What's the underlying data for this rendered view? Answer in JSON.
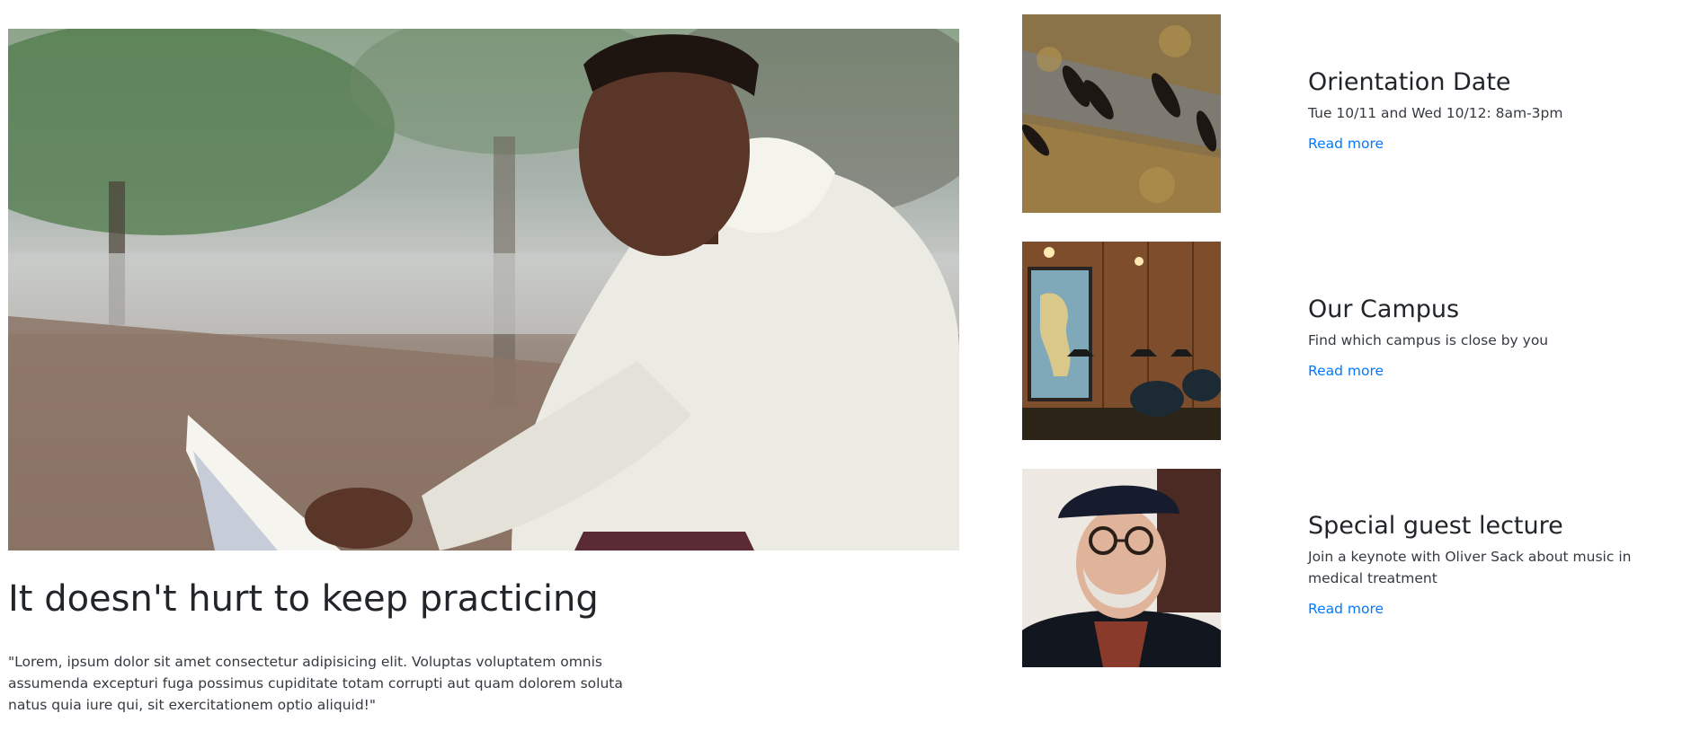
{
  "hero": {
    "image": "student-reading-book-photo",
    "title": "It doesn't hurt to keep practicing",
    "text": "\"Lorem, ipsum dolor sit amet consectetur adipisicing elit. Voluptas voluptatem omnis assumenda excepturi fuga possimus cupiditate totam corrupti aut quam dolorem soluta natus quia iure qui, sit exercitationem optio aliquid!\""
  },
  "cards": [
    {
      "image": "aerial-people-walking-photo",
      "title": "Orientation Date",
      "text": "Tue 10/11 and Wed 10/12: 8am-3pm",
      "link": "Read more"
    },
    {
      "image": "campus-cafe-interior-photo",
      "title": "Our Campus",
      "text": "Find which campus is close by you",
      "link": "Read more"
    },
    {
      "image": "elderly-man-beret-photo",
      "title": "Special guest lecture",
      "text": "Join a keynote with Oliver Sack about music in medical treatment",
      "link": "Read more"
    }
  ],
  "colors": {
    "link": "#007bff",
    "heading": "#212529",
    "body_text": "#343a40"
  }
}
